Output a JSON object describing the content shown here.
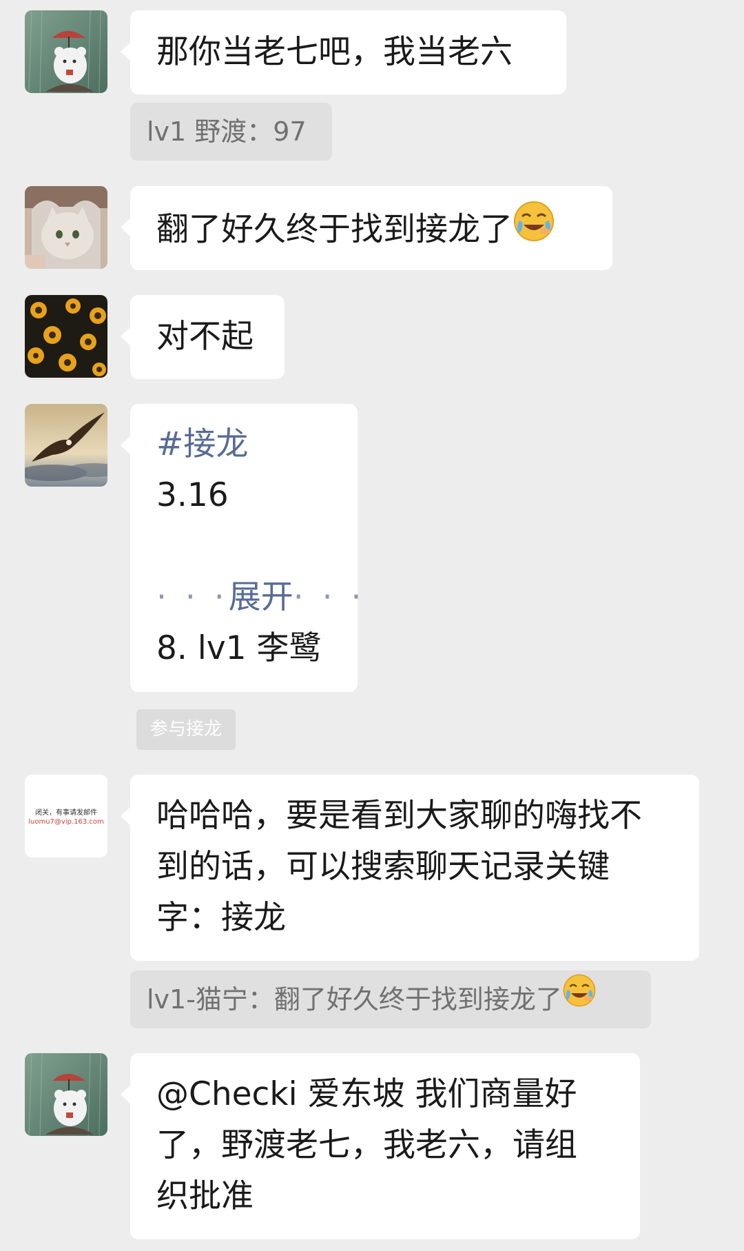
{
  "messages": [
    {
      "avatar_icon": "mouse-with-umbrella-avatar",
      "lines": [
        "那你当老七吧，我当老六"
      ]
    },
    {
      "quote": "lv1  野渡：97"
    },
    {
      "avatar_icon": "white-cat-avatar",
      "lines": [
        "翻了好久终于找到接龙了"
      ],
      "emoji": "face-with-tears-of-joy"
    },
    {
      "avatar_icon": "sunflower-avatar",
      "lines": [
        "对不起"
      ]
    },
    {
      "avatar_icon": "eagle-avatar",
      "solitaire": {
        "hashtag": "#接龙",
        "date": "3.16",
        "expand_dots_left": "· · ·",
        "expand_label": "展开",
        "expand_dots_right": "· · ·",
        "entry": "8. lv1 李鹭",
        "join_label": "参与接龙"
      }
    },
    {
      "avatar_icon": "text-card-avatar",
      "avatar_text": [
        "闭关，有事请发邮件",
        "luomu7@vip.163.com"
      ],
      "lines": [
        "哈哈哈，要是看到大家聊的嗨找不",
        "到的话，可以搜索聊天记录关键",
        "字：接龙"
      ]
    },
    {
      "quote": "lv1-猫宁：翻了好久终于找到接龙了",
      "emoji": "face-with-tears-of-joy"
    },
    {
      "avatar_icon": "mouse-with-umbrella-avatar",
      "lines": [
        "@Checki 爱东坡  我们商量好",
        "了，野渡老七，我老六，请组",
        "织批准"
      ]
    }
  ],
  "colors": {
    "background": "#ededed",
    "bubble": "#ffffff",
    "quote_bg": "#e0e0e0",
    "link_blue": "#576b95"
  }
}
